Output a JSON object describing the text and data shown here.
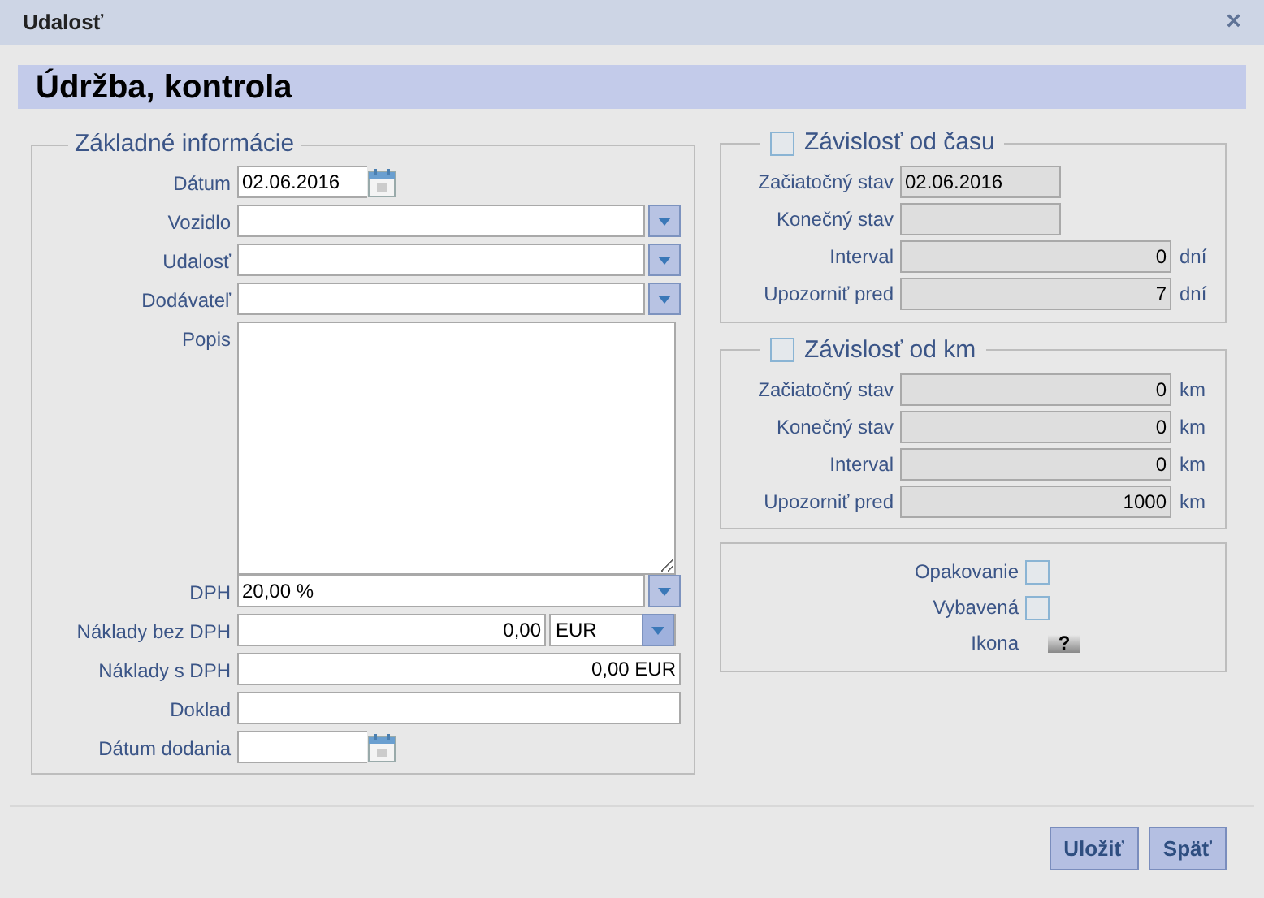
{
  "window": {
    "title": "Udalosť",
    "close": "×"
  },
  "heading": "Údržba, kontrola",
  "basic_info": {
    "legend": "Základné informácie",
    "fields": [
      {
        "kind": "date",
        "label": "Dátum",
        "value": "02.06.2016"
      },
      {
        "kind": "combo",
        "label": "Vozidlo"
      },
      {
        "kind": "combo",
        "label": "Udalosť"
      },
      {
        "kind": "combo",
        "label": "Dodávateľ"
      },
      {
        "kind": "textarea",
        "label": "Popis"
      },
      {
        "kind": "combo",
        "label": "DPH",
        "value": "20,00 %"
      },
      {
        "kind": "money",
        "label": "Náklady bez DPH",
        "value": "0,00",
        "currency": "EUR"
      },
      {
        "kind": "text",
        "label": "Náklady s DPH",
        "value": "0,00 EUR"
      },
      {
        "kind": "text",
        "label": "Doklad"
      },
      {
        "kind": "date",
        "label": "Dátum dodania"
      }
    ]
  },
  "time_dependency": {
    "legend": "Závislosť od času",
    "checked": false,
    "fields": [
      {
        "label": "Začiatočný stav",
        "value": "02.06.2016"
      },
      {
        "label": "Konečný stav"
      },
      {
        "label": "Interval",
        "value": "0",
        "unit": "dní"
      },
      {
        "label": "Upozorniť pred",
        "value": "7",
        "unit": "dní"
      }
    ]
  },
  "km_dependency": {
    "legend": "Závislosť od km",
    "checked": false,
    "fields": [
      {
        "label": "Začiatočný stav",
        "value": "0",
        "unit": "km"
      },
      {
        "label": "Konečný stav",
        "value": "0",
        "unit": "km"
      },
      {
        "label": "Interval",
        "value": "0",
        "unit": "km"
      },
      {
        "label": "Upozorniť pred",
        "value": "1000",
        "unit": "km"
      }
    ]
  },
  "options": [
    {
      "kind": "checkbox",
      "label": "Opakovanie",
      "checked": false
    },
    {
      "kind": "checkbox",
      "label": "Vybavená",
      "checked": false
    },
    {
      "kind": "icon",
      "label": "Ikona",
      "glyph": "?"
    }
  ],
  "buttons": [
    "Uložiť",
    "Späť"
  ]
}
